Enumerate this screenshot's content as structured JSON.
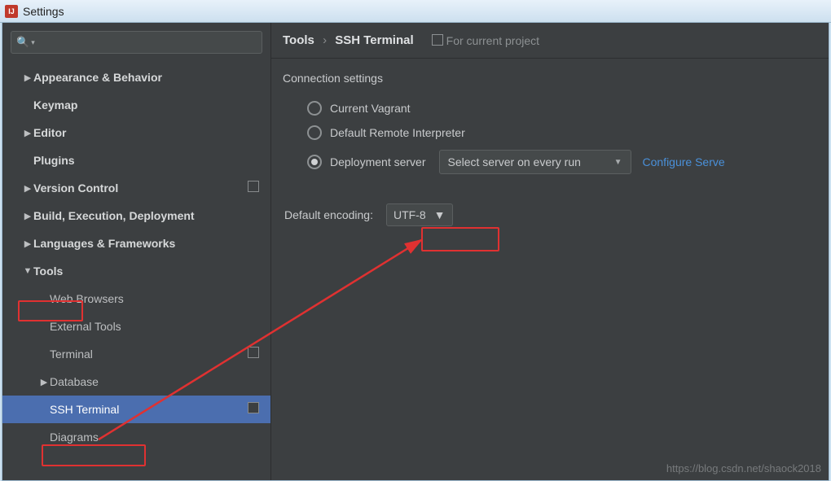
{
  "window": {
    "title": "Settings",
    "app_icon_text": "IJ"
  },
  "sidebar": {
    "search_placeholder": "",
    "items": [
      {
        "label": "Appearance & Behavior",
        "bold": true,
        "expander": "▶",
        "level": 0
      },
      {
        "label": "Keymap",
        "bold": true,
        "level": 0
      },
      {
        "label": "Editor",
        "bold": true,
        "expander": "▶",
        "level": 0
      },
      {
        "label": "Plugins",
        "bold": true,
        "level": 0
      },
      {
        "label": "Version Control",
        "bold": true,
        "expander": "▶",
        "level": 0,
        "copyable": true
      },
      {
        "label": "Build, Execution, Deployment",
        "bold": true,
        "expander": "▶",
        "level": 0
      },
      {
        "label": "Languages & Frameworks",
        "bold": true,
        "expander": "▶",
        "level": 0
      },
      {
        "label": "Tools",
        "bold": true,
        "expander": "▼",
        "level": 0
      },
      {
        "label": "Web Browsers",
        "level": 1
      },
      {
        "label": "External Tools",
        "level": 1
      },
      {
        "label": "Terminal",
        "level": 1,
        "copyable": true
      },
      {
        "label": "Database",
        "level": 1,
        "expander": "▶"
      },
      {
        "label": "SSH Terminal",
        "level": 1,
        "selected": true,
        "copyable": true
      },
      {
        "label": "Diagrams",
        "level": 1
      }
    ]
  },
  "breadcrumb": {
    "root": "Tools",
    "leaf": "SSH Terminal",
    "scope_label": "For current project"
  },
  "panel": {
    "section_title": "Connection settings",
    "radios": {
      "vagrant": "Current Vagrant",
      "remote_interp": "Default Remote Interpreter",
      "deploy": "Deployment server"
    },
    "deploy_select": "Select server on every run",
    "configure_link": "Configure Serve",
    "encoding_label": "Default encoding:",
    "encoding_value": "UTF-8"
  },
  "watermark": "https://blog.csdn.net/shaock2018"
}
